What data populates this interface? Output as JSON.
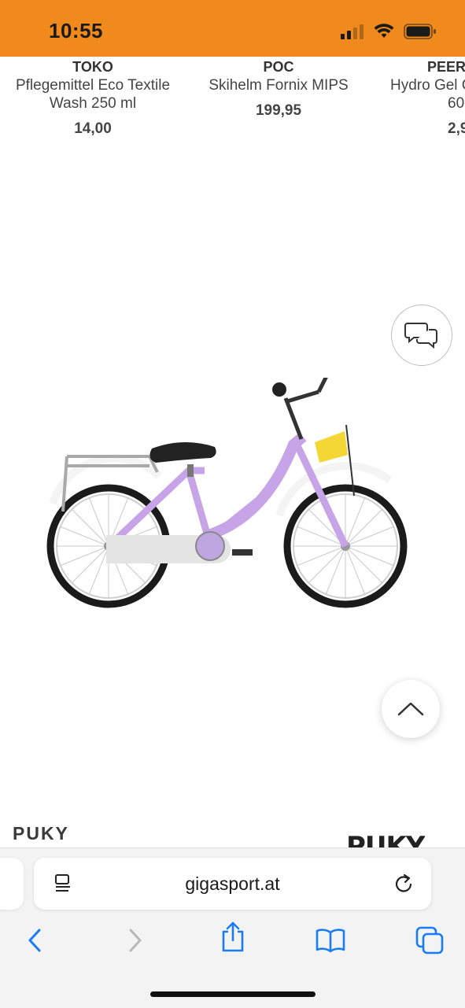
{
  "status_bar": {
    "time": "10:55"
  },
  "products": [
    {
      "brand": "TOKO",
      "name_line1": "Pflegemittel Eco Textile",
      "name_line2": "Wash 250 ml",
      "price": "14,00"
    },
    {
      "brand": "POC",
      "name_line1": "Skihelm Fornix MIPS",
      "name_line2": "",
      "price": "199,95"
    },
    {
      "brand": "PEERO",
      "name_line1": "Hydro Gel C",
      "name_line2": "60",
      "price": "2,9"
    }
  ],
  "product_image": {
    "description_brand": "PUKY"
  },
  "brand_section": {
    "label": "PUKY",
    "logo_text": "PUKY"
  },
  "browser": {
    "url": "gigasport.at"
  },
  "icons": {
    "chat": "chat-bubbles-icon",
    "scroll_top": "chevron-up-icon",
    "reader": "reader-mode-icon",
    "reload": "reload-icon",
    "back": "chevron-left-icon",
    "forward": "chevron-right-icon",
    "share": "share-icon",
    "bookmarks": "book-icon",
    "tabs": "tabs-icon"
  },
  "colors": {
    "header": "#f08a1c",
    "ios_blue": "#1a7cf5"
  }
}
